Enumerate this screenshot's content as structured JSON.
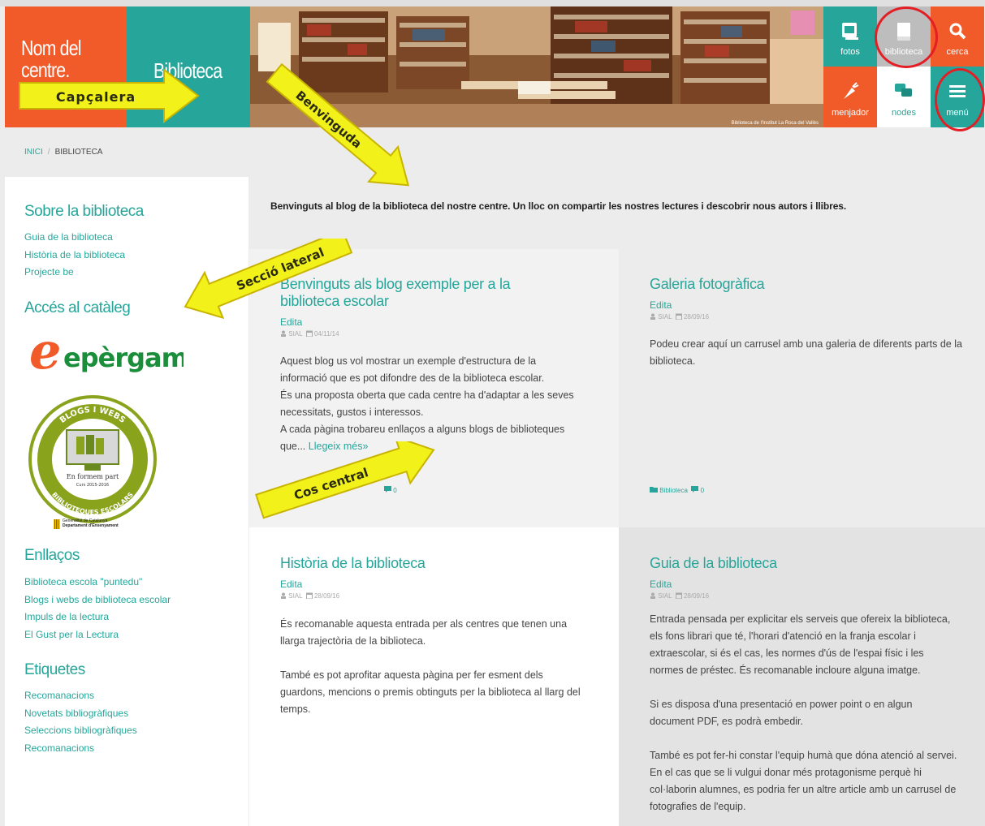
{
  "header": {
    "centre_name_line1": "Nom del",
    "centre_name_line2": "centre.",
    "library_title": "Biblioteca",
    "photo_caption": "Biblioteca de l'Institut La Roca del Vallès",
    "tiles": {
      "fotos": "fotos",
      "biblioteca": "biblioteca",
      "cerca": "cerca",
      "menjador": "menjador",
      "nodes": "nodes",
      "menu": "menú"
    }
  },
  "breadcrumb": {
    "home": "INICI",
    "separator": "/",
    "current": "BIBLIOTECA"
  },
  "annotations": {
    "capcalera": "Capçalera",
    "benvinguda": "Benvinguda",
    "seccio_lateral": "Secció lateral",
    "cos_central": "Cos central"
  },
  "sidebar": {
    "about_heading": "Sobre la biblioteca",
    "about_links": [
      "Guia de la biblioteca",
      "Història de la biblioteca",
      "Projecte be"
    ],
    "catalog_heading": "Accés al catàleg",
    "epergam_logo": "epèrgam",
    "badge": {
      "ring_top": "BLOGS I WEBS",
      "ring_bottom": "BIBLIOTEQUES ESCOLARS",
      "center_line1": "En formem part",
      "center_line2": "Curs 2015-2016"
    },
    "gencat_line1": "Generalitat de Catalunya",
    "gencat_line2": "Departament d'Ensenyament",
    "links_heading": "Enllaços",
    "links": [
      "Biblioteca escola \"puntedu\"",
      "Blogs i webs de biblioteca escolar",
      "Impuls de la lectura",
      "El Gust per la Lectura"
    ],
    "tags_heading": "Etiquetes",
    "tags": [
      "Recomanacions",
      "Novetats bibliogràfiques",
      "Seleccions bibliogràfiques",
      "Recomanacions"
    ]
  },
  "welcome_text": "Benvinguts al blog de la biblioteca del nostre centre. Un lloc on compartir les nostres lectures i descobrir nous autors i llibres.",
  "posts": [
    {
      "title": "Benvinguts als blog exemple per a la biblioteca escolar",
      "edit": "Edita",
      "author": "SIAL",
      "date": "04/11/14",
      "body": [
        "Aquest blog us vol mostrar un exemple d'estructura de la informació que es pot difondre des de la biblioteca escolar.",
        "És una proposta oberta que cada centre ha d'adaptar a les seves necessitats, gustos i interessos.",
        "A cada pàgina trobareu enllaços a alguns blogs de biblioteques que..."
      ],
      "read_more": "Llegeix més»",
      "comments": "0"
    },
    {
      "title": "Galeria fotogràfica",
      "edit": "Edita",
      "author": "SIAL",
      "date": "28/09/16",
      "body": [
        "Podeu crear aquí un carrusel amb una galeria de diferents parts de la biblioteca."
      ],
      "category": "Biblioteca",
      "comments": "0"
    },
    {
      "title": "Història de la biblioteca",
      "edit": "Edita",
      "author": "SIAL",
      "date": "28/09/16",
      "body": [
        "És recomanable aquesta entrada per als centres que tenen una llarga trajectòria de la biblioteca.",
        "També es pot aprofitar aquesta pàgina per fer esment dels guardons, mencions o premis obtinguts per la biblioteca al llarg del temps."
      ]
    },
    {
      "title": "Guia de la biblioteca",
      "edit": "Edita",
      "author": "SIAL",
      "date": "28/09/16",
      "body": [
        "Entrada pensada per explicitar els serveis que ofereix la biblioteca, els fons librari que té, l'horari d'atenció en la franja escolar i extraescolar, si és el cas, les normes d'ús de l'espai físic i les normes de préstec. És recomanable incloure alguna imatge.",
        "Si es disposa d'una presentació en power point o en algun document PDF, es podrà embedir.",
        "També es pot fer-hi constar l'equip humà que dóna atenció al servei. En el cas que se li vulgui donar més protagonisme perquè hi col·laborin alumnes, es podria fer un altre article amb un carrusel de fotografies de l'equip."
      ]
    }
  ],
  "colors": {
    "orange": "#f15a29",
    "teal": "#26a69a",
    "annotation_yellow": "#f2f21a",
    "highlight_red": "#e31e24"
  }
}
